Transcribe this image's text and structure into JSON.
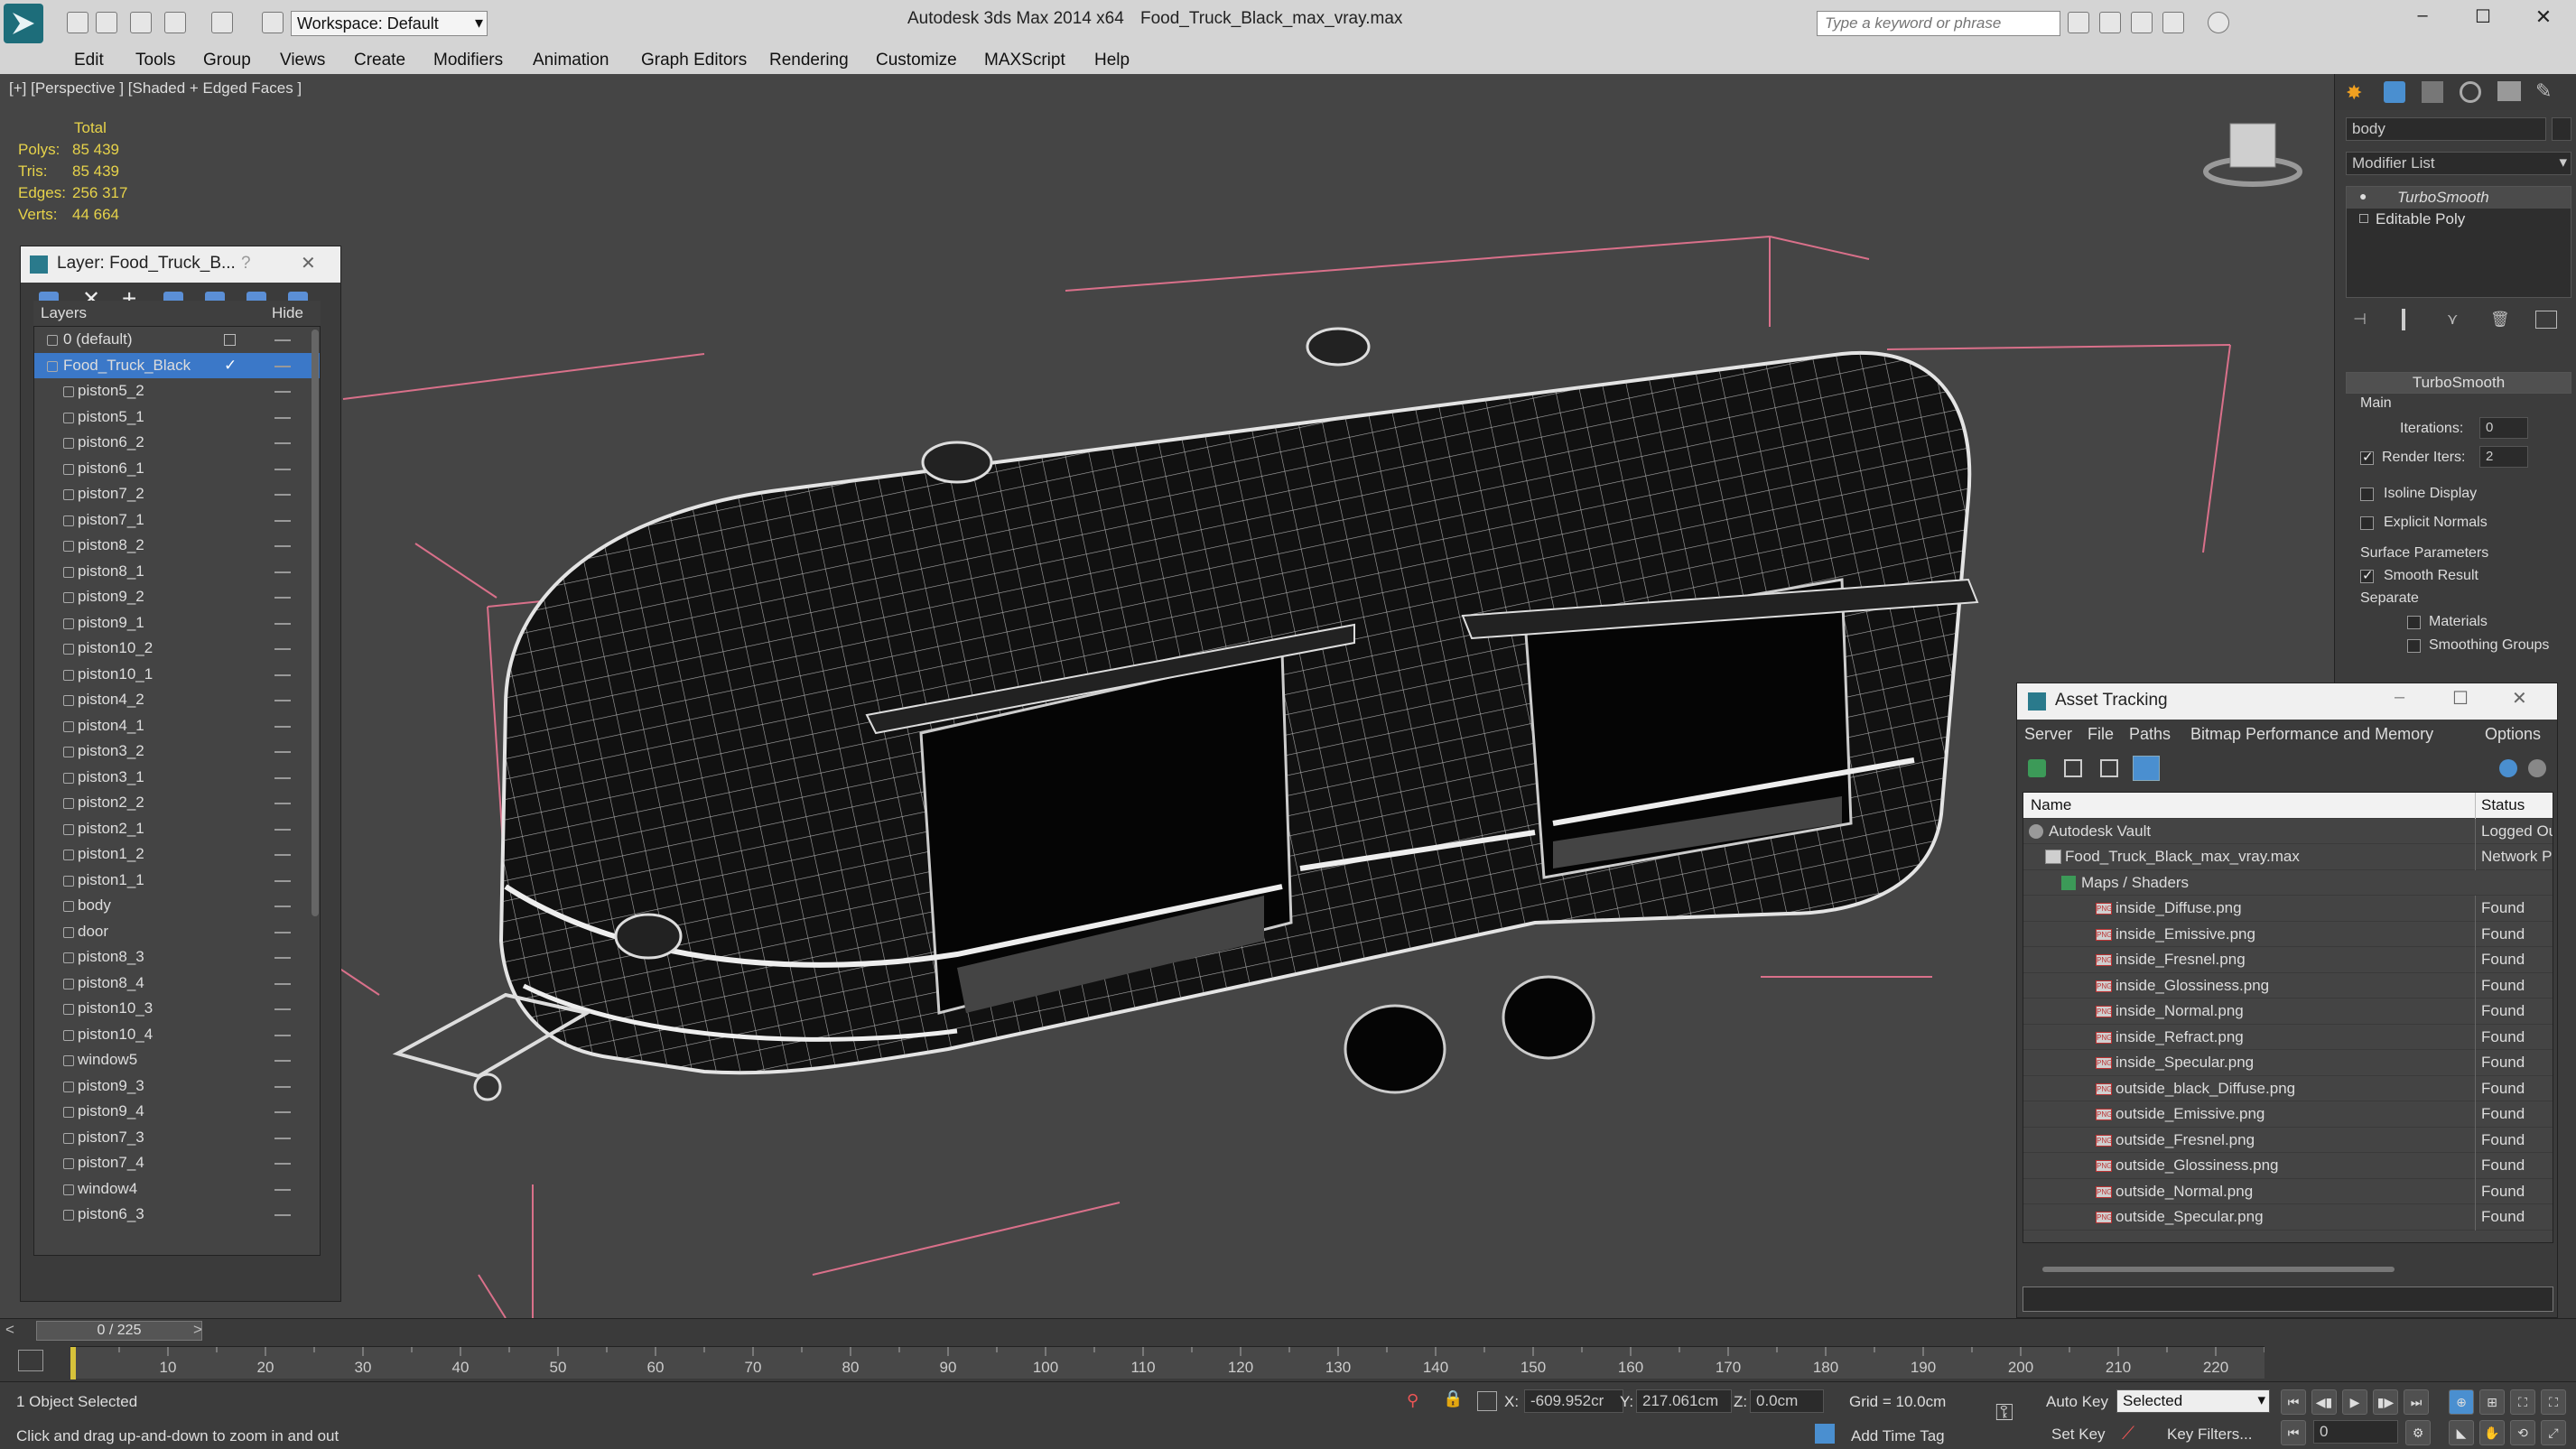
{
  "app": {
    "title": "Autodesk 3ds Max  2014 x64",
    "file": "Food_Truck_Black_max_vray.max",
    "workspace": "Workspace: Default",
    "search_placeholder": "Type a keyword or phrase"
  },
  "menu": [
    "Edit",
    "Tools",
    "Group",
    "Views",
    "Create",
    "Modifiers",
    "Animation",
    "Graph Editors",
    "Rendering",
    "Customize",
    "MAXScript",
    "Help"
  ],
  "viewport": {
    "label": "[+] [Perspective ] [Shaded + Edged Faces ]",
    "stats": {
      "header": "Total",
      "rows": [
        {
          "k": "Polys:",
          "v": "85 439"
        },
        {
          "k": "Tris:",
          "v": "85 439"
        },
        {
          "k": "Edges:",
          "v": "256 317"
        },
        {
          "k": "Verts:",
          "v": "44 664"
        }
      ]
    }
  },
  "layer_panel": {
    "title": "Layer: Food_Truck_B...",
    "help": "?",
    "col_layers": "Layers",
    "col_hide": "Hide",
    "items": [
      {
        "name": "0 (default)",
        "level": 0
      },
      {
        "name": "Food_Truck_Black",
        "level": 0,
        "selected": true
      },
      {
        "name": "piston5_2",
        "level": 1
      },
      {
        "name": "piston5_1",
        "level": 1
      },
      {
        "name": "piston6_2",
        "level": 1
      },
      {
        "name": "piston6_1",
        "level": 1
      },
      {
        "name": "piston7_2",
        "level": 1
      },
      {
        "name": "piston7_1",
        "level": 1
      },
      {
        "name": "piston8_2",
        "level": 1
      },
      {
        "name": "piston8_1",
        "level": 1
      },
      {
        "name": "piston9_2",
        "level": 1
      },
      {
        "name": "piston9_1",
        "level": 1
      },
      {
        "name": "piston10_2",
        "level": 1
      },
      {
        "name": "piston10_1",
        "level": 1
      },
      {
        "name": "piston4_2",
        "level": 1
      },
      {
        "name": "piston4_1",
        "level": 1
      },
      {
        "name": "piston3_2",
        "level": 1
      },
      {
        "name": "piston3_1",
        "level": 1
      },
      {
        "name": "piston2_2",
        "level": 1
      },
      {
        "name": "piston2_1",
        "level": 1
      },
      {
        "name": "piston1_2",
        "level": 1
      },
      {
        "name": "piston1_1",
        "level": 1
      },
      {
        "name": "body",
        "level": 1
      },
      {
        "name": "door",
        "level": 1
      },
      {
        "name": "piston8_3",
        "level": 1
      },
      {
        "name": "piston8_4",
        "level": 1
      },
      {
        "name": "piston10_3",
        "level": 1
      },
      {
        "name": "piston10_4",
        "level": 1
      },
      {
        "name": "window5",
        "level": 1
      },
      {
        "name": "piston9_3",
        "level": 1
      },
      {
        "name": "piston9_4",
        "level": 1
      },
      {
        "name": "piston7_3",
        "level": 1
      },
      {
        "name": "piston7_4",
        "level": 1
      },
      {
        "name": "window4",
        "level": 1
      },
      {
        "name": "piston6_3",
        "level": 1
      }
    ]
  },
  "command_panel": {
    "object_name": "body",
    "modifier_list": "Modifier List",
    "stack": [
      "TurboSmooth",
      "Editable Poly"
    ],
    "rollout": "TurboSmooth",
    "main": "Main",
    "iterations_label": "Iterations:",
    "iterations_value": "0",
    "render_iters_label": "Render Iters:",
    "render_iters_value": "2",
    "isoline": "Isoline Display",
    "explicit": "Explicit Normals",
    "surface": "Surface Parameters",
    "smooth_result": "Smooth Result",
    "separate": "Separate",
    "materials": "Materials",
    "smoothing_groups": "Smoothing Groups"
  },
  "asset_tracking": {
    "title": "Asset Tracking",
    "menu": [
      "Server",
      "File",
      "Paths",
      "Bitmap Performance and Memory",
      "Options"
    ],
    "col_name": "Name",
    "col_status": "Status",
    "rows": [
      {
        "name": "Autodesk Vault",
        "level": 0,
        "status": "Logged Ou",
        "icon": "vault"
      },
      {
        "name": "Food_Truck_Black_max_vray.max",
        "level": 1,
        "status": "Network P",
        "icon": "max"
      },
      {
        "name": "Maps / Shaders",
        "level": 2,
        "status": "",
        "icon": "folder"
      },
      {
        "name": "inside_Diffuse.png",
        "level": 3,
        "status": "Found",
        "icon": "png"
      },
      {
        "name": "inside_Emissive.png",
        "level": 3,
        "status": "Found",
        "icon": "png"
      },
      {
        "name": "inside_Fresnel.png",
        "level": 3,
        "status": "Found",
        "icon": "png"
      },
      {
        "name": "inside_Glossiness.png",
        "level": 3,
        "status": "Found",
        "icon": "png"
      },
      {
        "name": "inside_Normal.png",
        "level": 3,
        "status": "Found",
        "icon": "png"
      },
      {
        "name": "inside_Refract.png",
        "level": 3,
        "status": "Found",
        "icon": "png"
      },
      {
        "name": "inside_Specular.png",
        "level": 3,
        "status": "Found",
        "icon": "png"
      },
      {
        "name": "outside_black_Diffuse.png",
        "level": 3,
        "status": "Found",
        "icon": "png"
      },
      {
        "name": "outside_Emissive.png",
        "level": 3,
        "status": "Found",
        "icon": "png"
      },
      {
        "name": "outside_Fresnel.png",
        "level": 3,
        "status": "Found",
        "icon": "png"
      },
      {
        "name": "outside_Glossiness.png",
        "level": 3,
        "status": "Found",
        "icon": "png"
      },
      {
        "name": "outside_Normal.png",
        "level": 3,
        "status": "Found",
        "icon": "png"
      },
      {
        "name": "outside_Specular.png",
        "level": 3,
        "status": "Found",
        "icon": "png"
      }
    ]
  },
  "timeline": {
    "frame": "0 / 225",
    "ticks": [
      "0",
      "10",
      "20",
      "30",
      "40",
      "50",
      "60",
      "70",
      "80",
      "90",
      "100",
      "110",
      "120",
      "130",
      "140",
      "150",
      "160",
      "170",
      "180",
      "190",
      "200",
      "210",
      "220"
    ]
  },
  "status": {
    "selected": "1 Object Selected",
    "hint": "Click and drag up-and-down to zoom in and out",
    "x_label": "X:",
    "x": "-609.952cr",
    "y_label": "Y:",
    "y": "217.061cm",
    "z_label": "Z:",
    "z": "0.0cm",
    "grid": "Grid = 10.0cm",
    "add_time_tag": "Add Time Tag",
    "auto_key": "Auto Key",
    "selected_dropdown": "Selected",
    "set_key": "Set Key",
    "key_filters": "Key Filters...",
    "frame_field": "0"
  }
}
